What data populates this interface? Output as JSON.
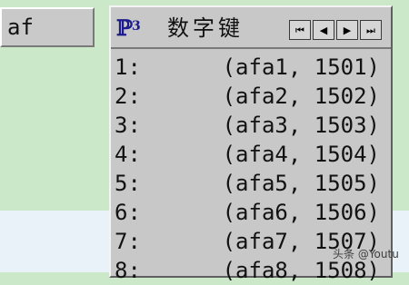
{
  "input": {
    "value": "af"
  },
  "candidate_window": {
    "logo_text": "ℙ",
    "logo_sup": "3",
    "title": "数字键",
    "nav": [
      {
        "label": "⏮"
      },
      {
        "label": "◀"
      },
      {
        "label": "▶"
      },
      {
        "label": "⏭"
      }
    ],
    "candidates": [
      {
        "index": "1:",
        "value": "(afa1, 1501)"
      },
      {
        "index": "2:",
        "value": "(afa2, 1502)"
      },
      {
        "index": "3:",
        "value": "(afa3, 1503)"
      },
      {
        "index": "4:",
        "value": "(afa4, 1504)"
      },
      {
        "index": "5:",
        "value": "(afa5, 1505)"
      },
      {
        "index": "6:",
        "value": "(afa6, 1506)"
      },
      {
        "index": "7:",
        "value": "(afa7, 1507)"
      },
      {
        "index": "8:",
        "value": "(afa8, 1508)"
      }
    ]
  },
  "watermark": {
    "text": "头条 @Youtu"
  },
  "colors": {
    "background_green": "#cbe8c8",
    "background_blue": "#e8f2f8",
    "panel_gray": "#c8c8c8",
    "logo_blue": "#1b1b8c"
  },
  "icons": {
    "logo": "ime-logo-icon",
    "first_page": "first-page-icon",
    "prev_page": "previous-page-icon",
    "next_page": "next-page-icon",
    "last_page": "last-page-icon"
  }
}
